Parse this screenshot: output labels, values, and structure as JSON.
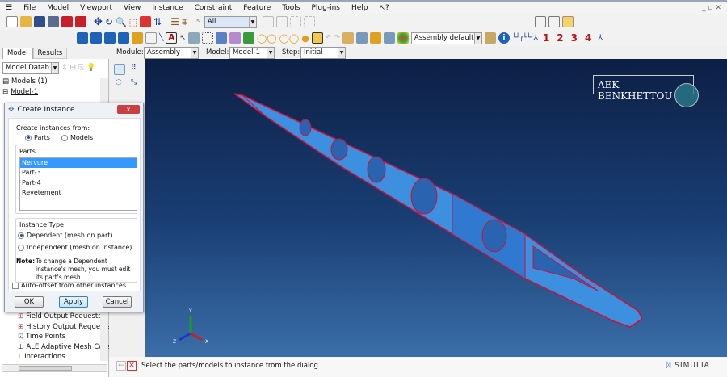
{
  "menu": [
    "File",
    "Model",
    "Viewport",
    "View",
    "Instance",
    "Constraint",
    "Feature",
    "Tools",
    "Plug-ins",
    "Help",
    "↖?"
  ],
  "toolbar": {
    "selection_filter": "All",
    "render_style": "Assembly defaults",
    "view_numbers": [
      "1",
      "2",
      "3",
      "4"
    ]
  },
  "context": {
    "module_label": "Module:",
    "module_value": "Assembly",
    "model_label": "Model:",
    "model_value": "Model-1",
    "step_label": "Step:",
    "step_value": "Initial"
  },
  "tabs": [
    "Model",
    "Results"
  ],
  "tree": {
    "database_select": "Model Datab",
    "top_items": [
      "Models (1)",
      "Model-1"
    ],
    "bottom_items": [
      "Field Output Requests",
      "History Output Requests",
      "Time Points",
      "ALE Adaptive Mesh Cons",
      "Interactions"
    ]
  },
  "dialog": {
    "title": "Create Instance",
    "close": "x",
    "create_from_label": "Create instances from:",
    "from_options": [
      "Parts",
      "Models"
    ],
    "parts_label": "Parts",
    "parts": [
      "Nervure",
      "Part-3",
      "Part-4",
      "Revetement"
    ],
    "instance_type_label": "Instance Type",
    "types": [
      "Dependent (mesh on part)",
      "Independent (mesh on instance)"
    ],
    "note_label": "Note:",
    "note_text": "To change a Dependent instance's mesh, you must edit its part's mesh.",
    "auto_offset": "Auto-offset from other instances",
    "ok": "OK",
    "apply": "Apply",
    "cancel": "Cancel"
  },
  "viewport": {
    "watermark": "AEK BENKHETTOU",
    "axes": [
      "Y",
      "X",
      "Z"
    ]
  },
  "status": {
    "prompt": "Select the parts/models to instance from the dialog",
    "brand": "SIMULIA"
  },
  "colors": {
    "part_fill": "#3d8fe0",
    "part_edge": "#d0103a",
    "selection": "#3399ff"
  }
}
